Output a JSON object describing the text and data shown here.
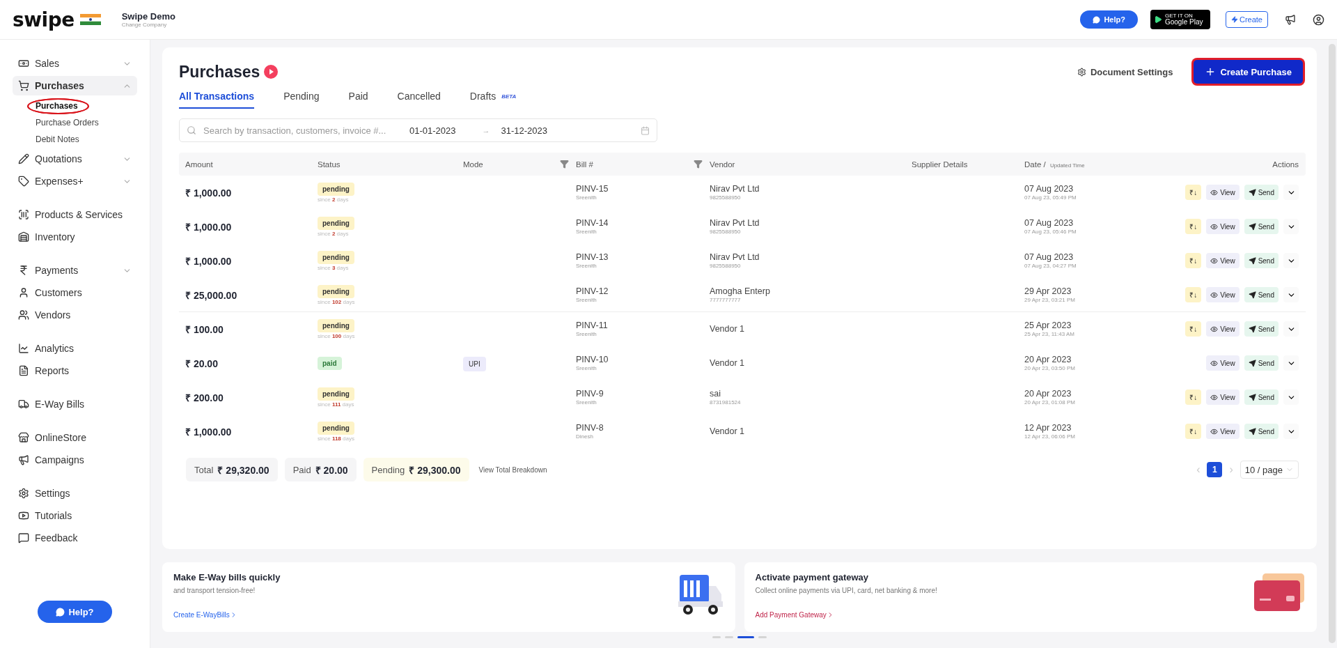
{
  "header": {
    "brand": "swipe",
    "company": "Swipe Demo",
    "change_company": "Change Company",
    "help": "Help?",
    "store_small": "GET IT ON",
    "store_big": "Google Play",
    "create": "Create"
  },
  "sidebar": {
    "sections": [
      {
        "items": [
          {
            "label": "Sales",
            "expanded": false,
            "selected": false
          },
          {
            "label": "Purchases",
            "expanded": true,
            "selected": true,
            "children": [
              {
                "label": "Purchases",
                "selected": true,
                "circled": true
              },
              {
                "label": "Purchase Orders",
                "selected": false,
                "circled": false
              },
              {
                "label": "Debit Notes",
                "selected": false,
                "circled": false
              }
            ]
          },
          {
            "label": "Quotations",
            "expanded": false,
            "selected": false
          },
          {
            "label": "Expenses+",
            "expanded": false,
            "selected": false
          }
        ]
      },
      {
        "items": [
          {
            "label": "Products & Services",
            "selected": false
          },
          {
            "label": "Inventory",
            "selected": false
          }
        ]
      },
      {
        "items": [
          {
            "label": "Payments",
            "expanded": false,
            "selected": false
          },
          {
            "label": "Customers",
            "selected": false
          },
          {
            "label": "Vendors",
            "selected": false
          }
        ]
      },
      {
        "items": [
          {
            "label": "Analytics",
            "selected": false
          },
          {
            "label": "Reports",
            "selected": false
          }
        ]
      },
      {
        "items": [
          {
            "label": "E-Way Bills",
            "selected": false
          }
        ]
      },
      {
        "items": [
          {
            "label": "OnlineStore",
            "selected": false
          },
          {
            "label": "Campaigns",
            "selected": false
          }
        ]
      },
      {
        "items": [
          {
            "label": "Settings",
            "selected": false
          },
          {
            "label": "Tutorials",
            "selected": false
          },
          {
            "label": "Feedback",
            "selected": false
          }
        ]
      }
    ],
    "help": "Help?"
  },
  "page": {
    "title": "Purchases",
    "document_settings": "Document Settings",
    "create_button": {
      "label": "Create Purchase",
      "highlighted": true
    },
    "tabs": [
      {
        "label": "All Transactions",
        "selected": true
      },
      {
        "label": "Pending",
        "selected": false
      },
      {
        "label": "Paid",
        "selected": false
      },
      {
        "label": "Cancelled",
        "selected": false
      },
      {
        "label": "Drafts",
        "selected": false,
        "badge": "BETA"
      }
    ],
    "search": {
      "placeholder": "Search by transaction, customers, invoice #..."
    },
    "date_from": "01-01-2023",
    "date_arrow": "→",
    "date_to": "31-12-2023"
  },
  "table": {
    "columns": [
      "Amount",
      "Status",
      "Mode",
      "Bill #",
      "Vendor",
      "Supplier Details",
      "Date / ",
      "Actions"
    ],
    "date_sub": "Updated Time",
    "rows": [
      {
        "amount": "₹ 1,000.00",
        "status": "pending",
        "since": "since **2** days",
        "bill": "PINV-15",
        "created_by": "Sreenith",
        "vendor": "Nirav Pvt Ltd",
        "phone": "9825588950",
        "date": "07 Aug 2023",
        "time": "07 Aug 23, 05:49 PM",
        "pay": "₹↓",
        "view": "View",
        "send": "Send"
      },
      {
        "amount": "₹ 1,000.00",
        "status": "pending",
        "since": "since **2** days",
        "bill": "PINV-14",
        "created_by": "Sreenith",
        "vendor": "Nirav Pvt Ltd",
        "phone": "9825588950",
        "date": "07 Aug 2023",
        "time": "07 Aug 23, 05:46 PM",
        "pay": "₹↓",
        "view": "View",
        "send": "Send"
      },
      {
        "amount": "₹ 1,000.00",
        "status": "pending",
        "since": "since **3** days",
        "bill": "PINV-13",
        "created_by": "Sreenith",
        "vendor": "Nirav Pvt Ltd",
        "phone": "9825588950",
        "date": "07 Aug 2023",
        "time": "07 Aug 23, 04:27 PM",
        "pay": "₹↓",
        "view": "View",
        "send": "Send"
      },
      {
        "amount": "₹ 25,000.00",
        "status": "pending",
        "since": "since **102** days",
        "bill": "PINV-12",
        "created_by": "Sreenith",
        "vendor": "Amogha Enterp",
        "phone": "7777777777",
        "date": "29 Apr 2023",
        "time": "29 Apr 23, 03:21 PM",
        "pay": "₹↓",
        "view": "View",
        "send": "Send"
      },
      {
        "amount": "₹ 100.00",
        "status": "pending",
        "since": "since **100** days",
        "bill": "PINV-11",
        "created_by": "Sreenith",
        "vendor": "Vendor 1",
        "date": "25 Apr 2023",
        "time": "25 Apr 23, 11:43 AM",
        "pay": "₹↓",
        "view": "View",
        "send": "Send"
      },
      {
        "amount": "₹ 20.00",
        "status": "paid",
        "mode": "UPI",
        "bill": "PINV-10",
        "created_by": "Sreenith",
        "vendor": "Vendor 1",
        "date": "20 Apr 2023",
        "time": "20 Apr 23, 03:50 PM",
        "view": "View",
        "send": "Send"
      },
      {
        "amount": "₹ 200.00",
        "status": "pending",
        "since": "since **111** days",
        "bill": "PINV-9",
        "created_by": "Sreenith",
        "vendor": "sai",
        "phone": "8731981524",
        "date": "20 Apr 2023",
        "time": "20 Apr 23, 01:08 PM",
        "pay": "₹↓",
        "view": "View",
        "send": "Send"
      },
      {
        "amount": "₹ 1,000.00",
        "status": "pending",
        "since": "since **118** days",
        "bill": "PINV-8",
        "created_by": "Dinesh",
        "vendor": "Vendor 1",
        "date": "12 Apr 2023",
        "time": "12 Apr 23, 06:06 PM",
        "pay": "₹↓",
        "view": "View",
        "send": "Send"
      }
    ]
  },
  "totals": [
    {
      "label": "Total",
      "value": "₹ 29,320.00",
      "kind": "total"
    },
    {
      "label": "Paid",
      "value": "₹ 20.00",
      "kind": "paid"
    },
    {
      "label": "Pending",
      "value": "₹ 29,300.00",
      "kind": "pending"
    }
  ],
  "view_breakdown": "View Total Breakdown",
  "pagination": {
    "prev": "‹",
    "page": "1",
    "next": "›",
    "page_size": "10 / page"
  },
  "banners": [
    {
      "title": "Make E-Way bills quickly",
      "text": "and transport tension-free!",
      "link": "Create E-WayBills",
      "kind": "eway"
    },
    {
      "title": "Activate payment gateway",
      "text": "Collect online payments via UPI, card, net banking & more!",
      "link": "Add Payment Gateway",
      "kind": "payment"
    }
  ],
  "carousel": [
    {
      "selected": false
    },
    {
      "selected": false
    },
    {
      "selected": true
    },
    {
      "selected": false
    }
  ]
}
